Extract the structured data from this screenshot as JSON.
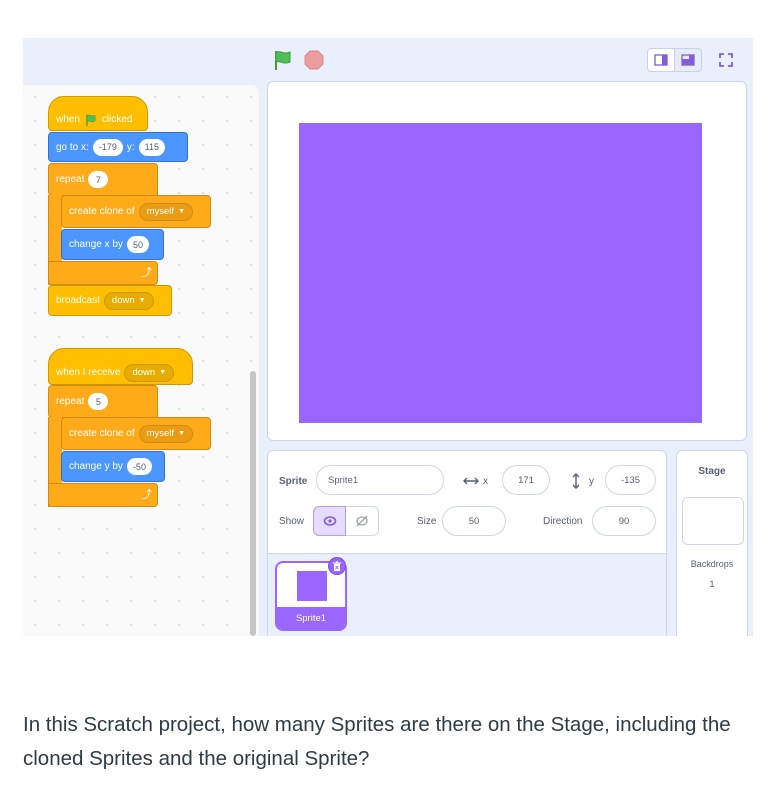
{
  "toolbar": {
    "green_flag_icon": "green-flag-icon",
    "stop_icon": "stop-sign-icon",
    "accent_flag": "#4cbf56",
    "accent_stop": "#ec9c9c"
  },
  "script1": {
    "when_label": "when",
    "clicked_label": "clicked",
    "goto_label": "go to x:",
    "x_value": "-179",
    "y_label": "y:",
    "y_value": "115",
    "repeat_label": "repeat",
    "repeat_count": "7",
    "clone_label": "create clone of",
    "clone_target": "myself",
    "changex_label": "change x by",
    "changex_value": "50",
    "broadcast_label": "broadcast",
    "broadcast_msg": "down"
  },
  "script2": {
    "receive_label": "when I receive",
    "receive_msg": "down",
    "repeat_label": "repeat",
    "repeat_count": "5",
    "clone_label": "create clone of",
    "clone_target": "myself",
    "changey_label": "change y by",
    "changey_value": "-50"
  },
  "sprite_info": {
    "sprite_label": "Sprite",
    "sprite_name": "Sprite1",
    "x_label": "x",
    "x_value": "171",
    "y_label": "y",
    "y_value": "-135",
    "show_label": "Show",
    "size_label": "Size",
    "size_value": "50",
    "direction_label": "Direction",
    "direction_value": "90"
  },
  "sprite_list": {
    "items": [
      {
        "name": "Sprite1",
        "color": "#9966ff"
      }
    ]
  },
  "stage_selector": {
    "title": "Stage",
    "backdrops_label": "Backdrops",
    "backdrops_count": "1"
  },
  "question": "In this Scratch project, how many Sprites are there on the Stage, including the cloned Sprites and the original Sprite?"
}
